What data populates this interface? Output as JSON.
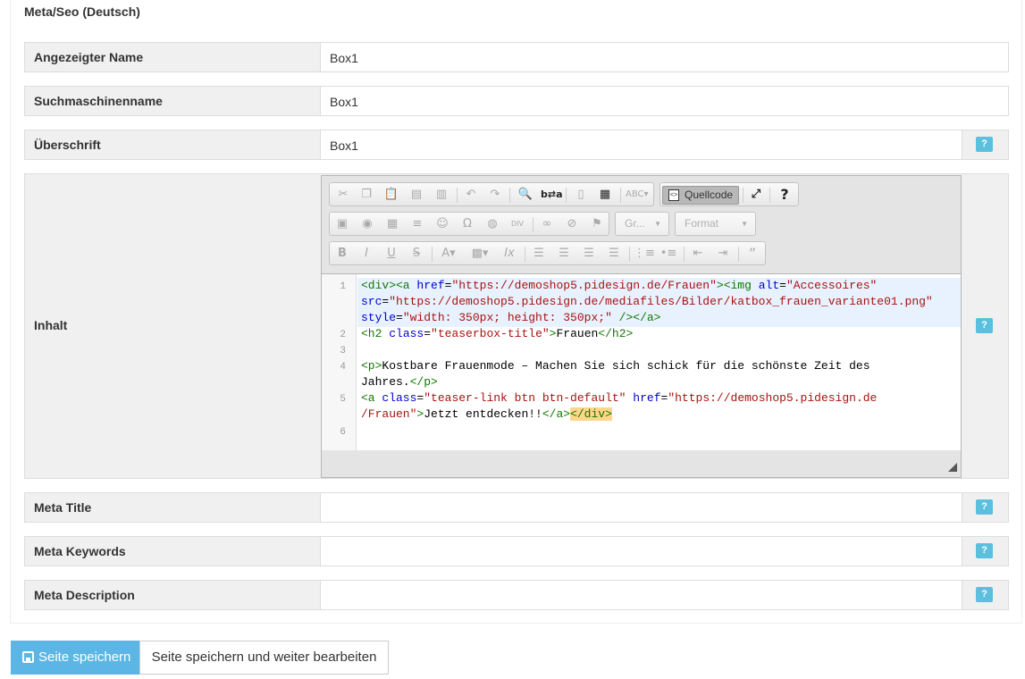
{
  "panel": {
    "title": "Meta/Seo (Deutsch)"
  },
  "fields": {
    "display_name": {
      "label": "Angezeigter Name",
      "value": "Box1"
    },
    "search_name": {
      "label": "Suchmaschinenname",
      "value": "Box1"
    },
    "heading": {
      "label": "Überschrift",
      "value": "Box1"
    },
    "content": {
      "label": "Inhalt"
    },
    "meta_title": {
      "label": "Meta Title",
      "value": ""
    },
    "meta_keywords": {
      "label": "Meta Keywords",
      "value": ""
    },
    "meta_description": {
      "label": "Meta Description",
      "value": ""
    }
  },
  "help_label": "?",
  "editor": {
    "source_button": "Quellcode",
    "combo_size": "Gr...",
    "combo_format": "Format",
    "line_numbers": [
      "1",
      "2",
      "3",
      "4",
      "5",
      "6"
    ],
    "code": {
      "l1a_open": "<div><a ",
      "l1a_attr1": "href",
      "l1a_eq1": "=",
      "l1a_val1": "\"https://demoshop5.pidesign.de/Frauen\"",
      "l1a_tag2": "><img ",
      "l1a_attr2": "alt",
      "l1a_eq2": "=",
      "l1a_val2": "\"Accessoires\"",
      "l1b_attr": "src",
      "l1b_eq": "=",
      "l1b_val": "\"https://demoshop5.pidesign.de/mediafiles/Bilder/katbox_frauen_variante01.png\"",
      "l1c_attr": "style",
      "l1c_eq": "=",
      "l1c_val": "\"width: 350px; height: 350px;\"",
      "l1c_close": " /></a>",
      "l2_open": "<h2 ",
      "l2_attr": "class",
      "l2_eq": "=",
      "l2_val": "\"teaserbox-title\"",
      "l2_gt": ">",
      "l2_text": "Frauen",
      "l2_close": "</h2>",
      "l4_open": "<p>",
      "l4_text_a": "Kostbare Frauenmode – Machen Sie sich schick für die schönste Zeit des",
      "l4_text_b": "Jahres.",
      "l4_close": "</p>",
      "l5_open": "<a ",
      "l5_attr1": "class",
      "l5_eq1": "=",
      "l5_val1": "\"teaser-link btn btn-default\"",
      "l5_attr2": " href",
      "l5_eq2": "=",
      "l5_val2a": "\"https://demoshop5.pidesign.de",
      "l5_val2b": "/Frauen\"",
      "l5_gt": ">",
      "l5_text": "Jetzt entdecken!!",
      "l5_close_a": "</a>",
      "l5_close_div": "</div>"
    }
  },
  "actions": {
    "save": "Seite speichern",
    "save_continue": "Seite speichern und weiter bearbeiten"
  }
}
